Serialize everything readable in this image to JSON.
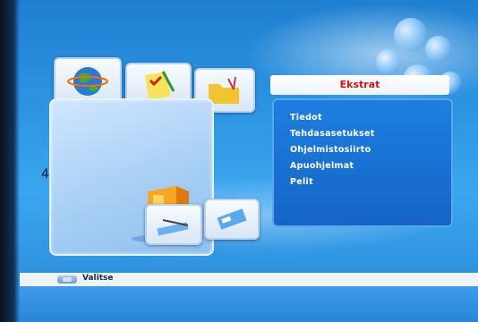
{
  "menu": {
    "title": "Ekstrat",
    "items": [
      "Tiedot",
      "Tehdasasetukset",
      "Ohjelmistosiirto",
      "Apuohjelmat",
      "Pelit"
    ]
  },
  "main_panel": {
    "number": "4"
  },
  "status_bar": {
    "select_label": "Valitse"
  },
  "colors": {
    "title_text": "#d81010",
    "menu_bg": "#1565c6",
    "panel": "#a8cff5"
  }
}
